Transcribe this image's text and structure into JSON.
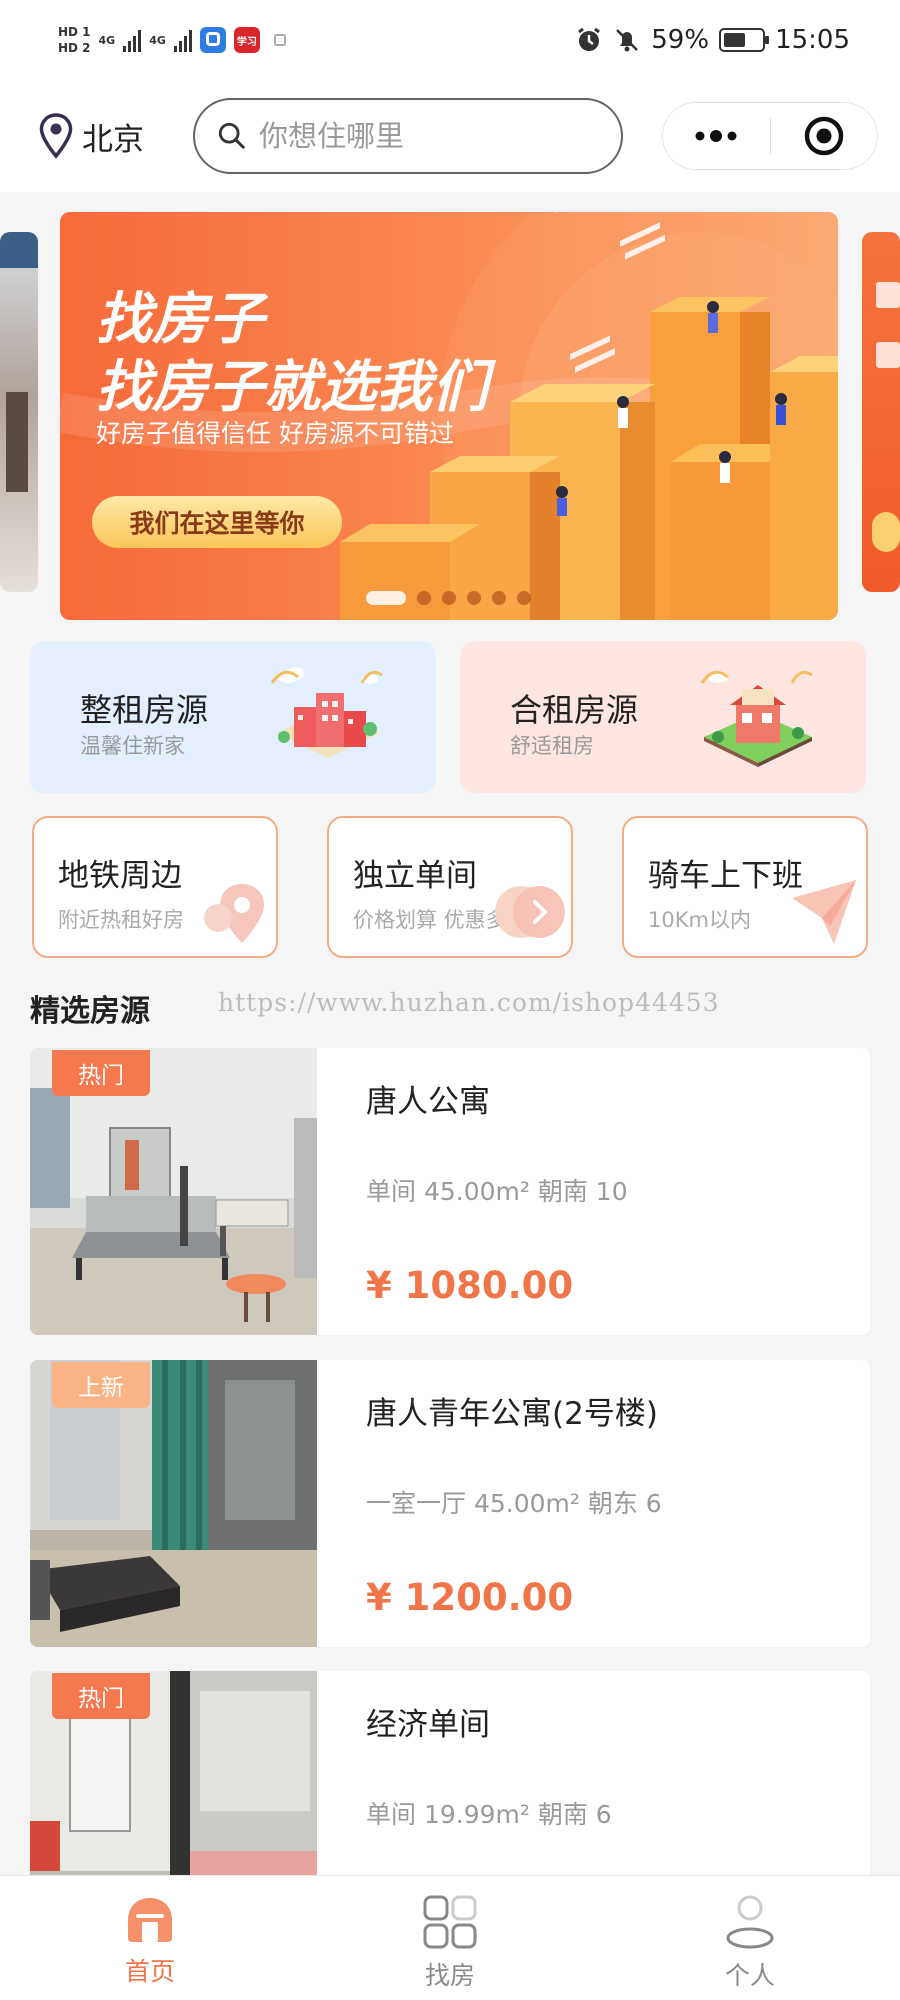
{
  "status_bar": {
    "hd1": "HD 1",
    "hd2": "HD 2",
    "net1": "4G",
    "net2": "4G",
    "app_badge": "学习",
    "battery_percent": 59,
    "battery_text": "59%",
    "time": "15:05"
  },
  "header": {
    "city": "北京",
    "search_placeholder": "你想住哪里",
    "location_icon": "location-pin-icon",
    "search_icon": "magnifier-icon"
  },
  "banner": {
    "title_line1": "找房子",
    "title_line2": "找房子就选我们",
    "subtitle": "好房子值得信任 好房源不可错过",
    "button_label": "我们在这里等你",
    "slide_count": 6,
    "active_slide": 0
  },
  "big_cards": [
    {
      "title": "整租房源",
      "subtitle": "温馨住新家",
      "bg": "#e3efff"
    },
    {
      "title": "合租房源",
      "subtitle": "舒适租房",
      "bg": "#fde6e1"
    }
  ],
  "small_cards": [
    {
      "title": "地铁周边",
      "subtitle": "附近热租好房"
    },
    {
      "title": "独立单间",
      "subtitle": "价格划算 优惠多"
    },
    {
      "title": "骑车上下班",
      "subtitle": "10Km以内"
    }
  ],
  "section": {
    "title": "精选房源",
    "watermark": "https://www.huzhan.com/ishop44453"
  },
  "listings": [
    {
      "tag": "热门",
      "tag_color": "#f5784f",
      "title": "唐人公寓",
      "meta": "单间 45.00m² 朝南 10",
      "price": "¥ 1080.00"
    },
    {
      "tag": "上新",
      "tag_color": "#f9b384",
      "title": "唐人青年公寓(2号楼)",
      "meta": "一室一厅 45.00m² 朝东 6",
      "price": "¥ 1200.00"
    },
    {
      "tag": "热门",
      "tag_color": "#f5784f",
      "title": "经济单间",
      "meta": "单间 19.99m² 朝南 6",
      "price": ""
    }
  ],
  "tabbar": [
    {
      "label": "首页",
      "icon": "home-icon",
      "active": true
    },
    {
      "label": "找房",
      "icon": "grid-icon",
      "active": false
    },
    {
      "label": "个人",
      "icon": "person-icon",
      "active": false
    }
  ],
  "colors": {
    "accent": "#f0764a",
    "card_border": "#f3ad85"
  }
}
